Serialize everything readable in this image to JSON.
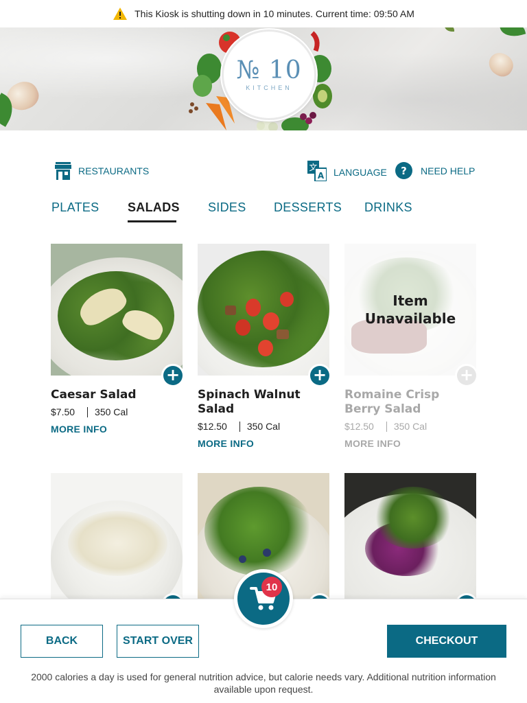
{
  "alert": {
    "icon": "warning-icon",
    "message": "This Kiosk is shutting down in 10 minutes. Current time: 09:50 AM"
  },
  "brand": {
    "logo_main": "№ 10",
    "logo_sub": "KITCHEN"
  },
  "topnav": {
    "restaurants": "RESTAURANTS",
    "language": "LANGUAGE",
    "help": "NEED HELP"
  },
  "tabs": [
    {
      "label": "PLATES",
      "active": false
    },
    {
      "label": "SALADS",
      "active": true
    },
    {
      "label": "SIDES",
      "active": false
    },
    {
      "label": "DESSERTS",
      "active": false
    },
    {
      "label": "DRINKS",
      "active": false
    }
  ],
  "products": [
    {
      "name": "Caesar Salad",
      "price": "$7.50",
      "calories": "350 Cal",
      "more": "MORE INFO",
      "available": true
    },
    {
      "name": "Spinach Walnut Salad",
      "price": "$12.50",
      "calories": "350 Cal",
      "more": "MORE INFO",
      "available": true
    },
    {
      "name": "Romaine Crisp Berry Salad",
      "price": "$12.50",
      "calories": "350 Cal",
      "more": "MORE INFO",
      "available": false,
      "overlay": "Item Unavailable"
    },
    {
      "name": "",
      "available": true
    },
    {
      "name": "",
      "available": true
    },
    {
      "name": "",
      "available": true
    }
  ],
  "cart": {
    "count": "10"
  },
  "footer": {
    "back": "BACK",
    "start_over": "START OVER",
    "checkout": "CHECKOUT",
    "disclaimer": "2000 calories a day is used for general nutrition advice, but calorie needs vary. Additional nutrition information available upon request."
  },
  "colors": {
    "accent": "#0b6a84",
    "badge": "#e0344a",
    "warning": "#f2b705"
  }
}
